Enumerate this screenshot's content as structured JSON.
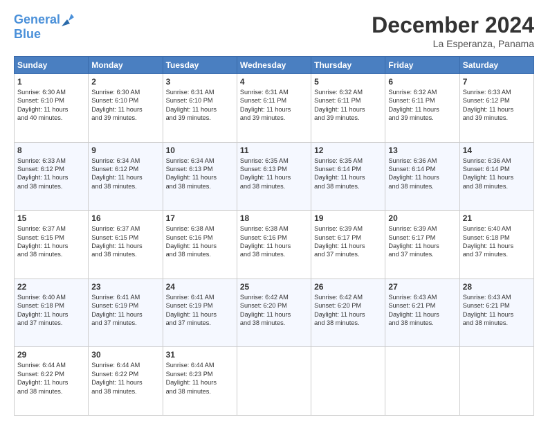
{
  "header": {
    "logo_line1": "General",
    "logo_line2": "Blue",
    "month": "December 2024",
    "location": "La Esperanza, Panama"
  },
  "weekdays": [
    "Sunday",
    "Monday",
    "Tuesday",
    "Wednesday",
    "Thursday",
    "Friday",
    "Saturday"
  ],
  "weeks": [
    [
      {
        "day": "1",
        "lines": [
          "Sunrise: 6:30 AM",
          "Sunset: 6:10 PM",
          "Daylight: 11 hours",
          "and 40 minutes."
        ]
      },
      {
        "day": "2",
        "lines": [
          "Sunrise: 6:30 AM",
          "Sunset: 6:10 PM",
          "Daylight: 11 hours",
          "and 39 minutes."
        ]
      },
      {
        "day": "3",
        "lines": [
          "Sunrise: 6:31 AM",
          "Sunset: 6:10 PM",
          "Daylight: 11 hours",
          "and 39 minutes."
        ]
      },
      {
        "day": "4",
        "lines": [
          "Sunrise: 6:31 AM",
          "Sunset: 6:11 PM",
          "Daylight: 11 hours",
          "and 39 minutes."
        ]
      },
      {
        "day": "5",
        "lines": [
          "Sunrise: 6:32 AM",
          "Sunset: 6:11 PM",
          "Daylight: 11 hours",
          "and 39 minutes."
        ]
      },
      {
        "day": "6",
        "lines": [
          "Sunrise: 6:32 AM",
          "Sunset: 6:11 PM",
          "Daylight: 11 hours",
          "and 39 minutes."
        ]
      },
      {
        "day": "7",
        "lines": [
          "Sunrise: 6:33 AM",
          "Sunset: 6:12 PM",
          "Daylight: 11 hours",
          "and 39 minutes."
        ]
      }
    ],
    [
      {
        "day": "8",
        "lines": [
          "Sunrise: 6:33 AM",
          "Sunset: 6:12 PM",
          "Daylight: 11 hours",
          "and 38 minutes."
        ]
      },
      {
        "day": "9",
        "lines": [
          "Sunrise: 6:34 AM",
          "Sunset: 6:12 PM",
          "Daylight: 11 hours",
          "and 38 minutes."
        ]
      },
      {
        "day": "10",
        "lines": [
          "Sunrise: 6:34 AM",
          "Sunset: 6:13 PM",
          "Daylight: 11 hours",
          "and 38 minutes."
        ]
      },
      {
        "day": "11",
        "lines": [
          "Sunrise: 6:35 AM",
          "Sunset: 6:13 PM",
          "Daylight: 11 hours",
          "and 38 minutes."
        ]
      },
      {
        "day": "12",
        "lines": [
          "Sunrise: 6:35 AM",
          "Sunset: 6:14 PM",
          "Daylight: 11 hours",
          "and 38 minutes."
        ]
      },
      {
        "day": "13",
        "lines": [
          "Sunrise: 6:36 AM",
          "Sunset: 6:14 PM",
          "Daylight: 11 hours",
          "and 38 minutes."
        ]
      },
      {
        "day": "14",
        "lines": [
          "Sunrise: 6:36 AM",
          "Sunset: 6:14 PM",
          "Daylight: 11 hours",
          "and 38 minutes."
        ]
      }
    ],
    [
      {
        "day": "15",
        "lines": [
          "Sunrise: 6:37 AM",
          "Sunset: 6:15 PM",
          "Daylight: 11 hours",
          "and 38 minutes."
        ]
      },
      {
        "day": "16",
        "lines": [
          "Sunrise: 6:37 AM",
          "Sunset: 6:15 PM",
          "Daylight: 11 hours",
          "and 38 minutes."
        ]
      },
      {
        "day": "17",
        "lines": [
          "Sunrise: 6:38 AM",
          "Sunset: 6:16 PM",
          "Daylight: 11 hours",
          "and 38 minutes."
        ]
      },
      {
        "day": "18",
        "lines": [
          "Sunrise: 6:38 AM",
          "Sunset: 6:16 PM",
          "Daylight: 11 hours",
          "and 38 minutes."
        ]
      },
      {
        "day": "19",
        "lines": [
          "Sunrise: 6:39 AM",
          "Sunset: 6:17 PM",
          "Daylight: 11 hours",
          "and 37 minutes."
        ]
      },
      {
        "day": "20",
        "lines": [
          "Sunrise: 6:39 AM",
          "Sunset: 6:17 PM",
          "Daylight: 11 hours",
          "and 37 minutes."
        ]
      },
      {
        "day": "21",
        "lines": [
          "Sunrise: 6:40 AM",
          "Sunset: 6:18 PM",
          "Daylight: 11 hours",
          "and 37 minutes."
        ]
      }
    ],
    [
      {
        "day": "22",
        "lines": [
          "Sunrise: 6:40 AM",
          "Sunset: 6:18 PM",
          "Daylight: 11 hours",
          "and 37 minutes."
        ]
      },
      {
        "day": "23",
        "lines": [
          "Sunrise: 6:41 AM",
          "Sunset: 6:19 PM",
          "Daylight: 11 hours",
          "and 37 minutes."
        ]
      },
      {
        "day": "24",
        "lines": [
          "Sunrise: 6:41 AM",
          "Sunset: 6:19 PM",
          "Daylight: 11 hours",
          "and 37 minutes."
        ]
      },
      {
        "day": "25",
        "lines": [
          "Sunrise: 6:42 AM",
          "Sunset: 6:20 PM",
          "Daylight: 11 hours",
          "and 38 minutes."
        ]
      },
      {
        "day": "26",
        "lines": [
          "Sunrise: 6:42 AM",
          "Sunset: 6:20 PM",
          "Daylight: 11 hours",
          "and 38 minutes."
        ]
      },
      {
        "day": "27",
        "lines": [
          "Sunrise: 6:43 AM",
          "Sunset: 6:21 PM",
          "Daylight: 11 hours",
          "and 38 minutes."
        ]
      },
      {
        "day": "28",
        "lines": [
          "Sunrise: 6:43 AM",
          "Sunset: 6:21 PM",
          "Daylight: 11 hours",
          "and 38 minutes."
        ]
      }
    ],
    [
      {
        "day": "29",
        "lines": [
          "Sunrise: 6:44 AM",
          "Sunset: 6:22 PM",
          "Daylight: 11 hours",
          "and 38 minutes."
        ]
      },
      {
        "day": "30",
        "lines": [
          "Sunrise: 6:44 AM",
          "Sunset: 6:22 PM",
          "Daylight: 11 hours",
          "and 38 minutes."
        ]
      },
      {
        "day": "31",
        "lines": [
          "Sunrise: 6:44 AM",
          "Sunset: 6:23 PM",
          "Daylight: 11 hours",
          "and 38 minutes."
        ]
      },
      null,
      null,
      null,
      null
    ]
  ]
}
